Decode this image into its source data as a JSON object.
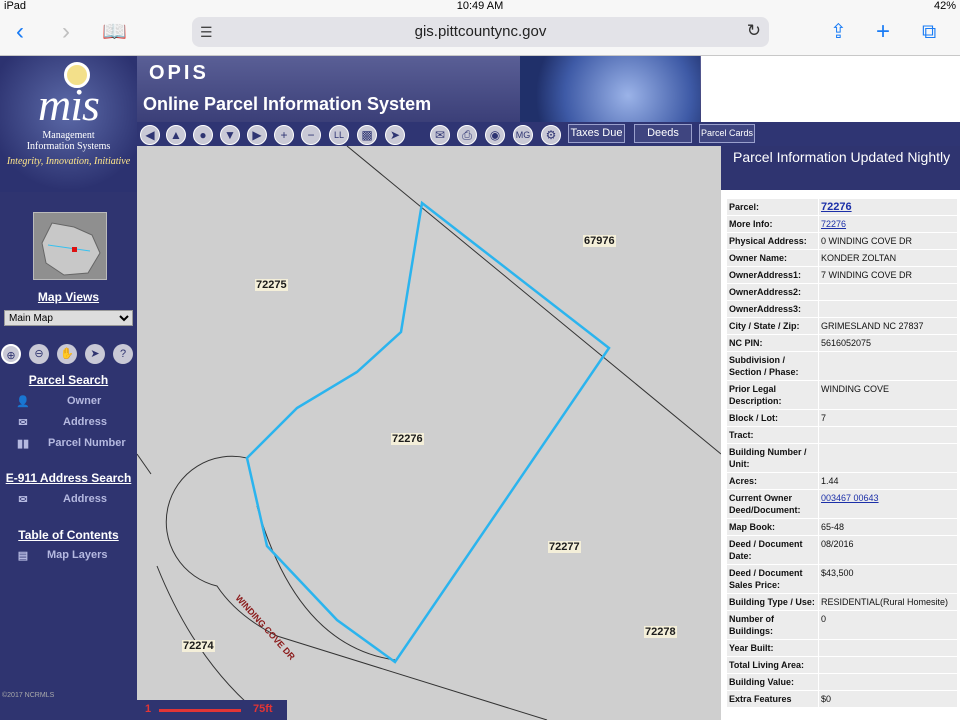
{
  "status_bar": {
    "device": "iPad",
    "time": "10:49 AM",
    "battery": "42%"
  },
  "browser": {
    "url": "gis.pittcountync.gov",
    "back_icon": "chevron-left",
    "forward_icon": "chevron-right"
  },
  "banner": {
    "logo_text": "mis",
    "logo_sub1": "Management",
    "logo_sub2": "Information Systems",
    "logo_tagline": "Integrity, Innovation, Initiative",
    "title_short": "OPIS",
    "title_full": "Online Parcel Information System"
  },
  "toolbar": {
    "taxes_due": "Taxes Due",
    "deeds": "Deeds",
    "parcel_cards": "Parcel Cards",
    "ll": "LL",
    "mg": "MG"
  },
  "sidebar": {
    "map_views": "Map Views",
    "map_select": "Main Map",
    "parcel_search": "Parcel Search",
    "owner": "Owner",
    "address": "Address",
    "parcel_number": "Parcel Number",
    "e911_search": "E-911 Address Search",
    "e911_address": "Address",
    "toc": "Table of Contents",
    "map_layers": "Map Layers",
    "copyright": "©2017 NCRMLS"
  },
  "map": {
    "parcels": [
      "72275",
      "67976",
      "72276",
      "72277",
      "72278",
      "72274"
    ],
    "street": "WINDING COVE DR",
    "scale_start": "1",
    "scale_end": "75ft"
  },
  "info": {
    "header": "Parcel Information Updated Nightly",
    "rows": [
      {
        "k": "Parcel:",
        "v": "72276"
      },
      {
        "k": "More Info:",
        "v": "72276"
      },
      {
        "k": "Physical Address:",
        "v": "0 WINDING COVE DR"
      },
      {
        "k": "Owner Name:",
        "v": "KONDER ZOLTAN"
      },
      {
        "k": "OwnerAddress1:",
        "v": "7 WINDING COVE DR"
      },
      {
        "k": "OwnerAddress2:",
        "v": ""
      },
      {
        "k": "OwnerAddress3:",
        "v": ""
      },
      {
        "k": "City / State / Zip:",
        "v": "GRIMESLAND NC 27837"
      },
      {
        "k": "NC PIN:",
        "v": "5616052075"
      },
      {
        "k": "Subdivision / Section / Phase:",
        "v": ""
      },
      {
        "k": "Prior Legal Description:",
        "v": "WINDING COVE"
      },
      {
        "k": "Block / Lot:",
        "v": "7"
      },
      {
        "k": "Tract:",
        "v": ""
      },
      {
        "k": "Building Number / Unit:",
        "v": ""
      },
      {
        "k": "Acres:",
        "v": "1.44"
      },
      {
        "k": "Current Owner Deed/Document:",
        "v": "003467 00643"
      },
      {
        "k": "Map Book:",
        "v": "65-48"
      },
      {
        "k": "Deed / Document Date:",
        "v": "08/2016"
      },
      {
        "k": "Deed / Document Sales Price:",
        "v": "$43,500"
      },
      {
        "k": "Building Type / Use:",
        "v": "RESIDENTIAL(Rural Homesite)"
      },
      {
        "k": "Number of Buildings:",
        "v": "0"
      },
      {
        "k": "Year Built:",
        "v": ""
      },
      {
        "k": "Total Living Area:",
        "v": ""
      },
      {
        "k": "Building Value:",
        "v": ""
      },
      {
        "k": "Extra Features",
        "v": "$0"
      }
    ]
  },
  "colors": {
    "navy": "#2f3470",
    "parcel_highlight": "#2bb4ee",
    "link": "#1b2fa8"
  }
}
